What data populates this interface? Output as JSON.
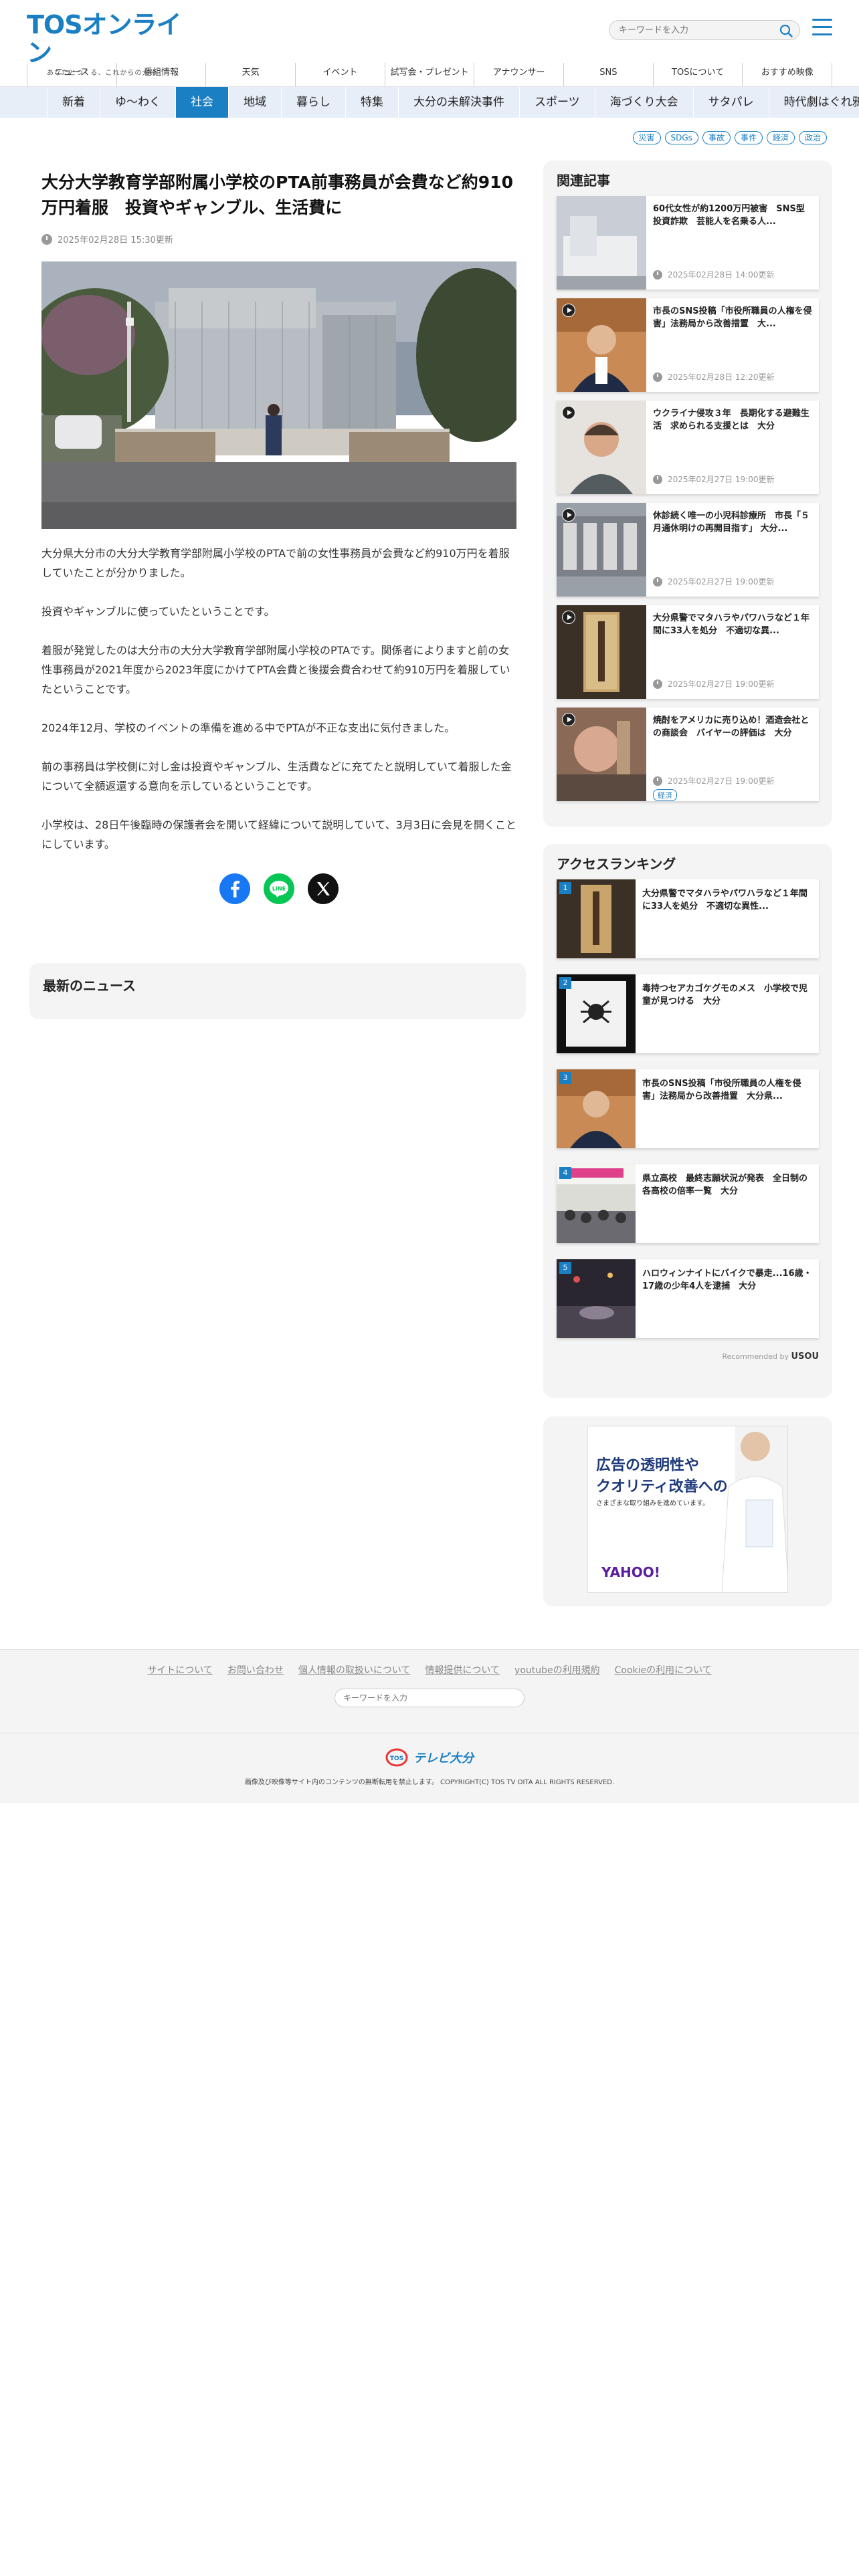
{
  "header": {
    "logo_main": "TOSオンライン",
    "logo_sub": "あなたとつくる、これからの大分",
    "search_placeholder": "キーワードを入力"
  },
  "top_nav": [
    "ニュース",
    "番組情報",
    "天気",
    "イベント",
    "試写会・プレゼント",
    "アナウンサー",
    "SNS",
    "TOSについて",
    "おすすめ映像"
  ],
  "category_nav": {
    "items": [
      "新着",
      "ゆ〜わく",
      "社会",
      "地域",
      "暮らし",
      "特集",
      "大分の未解決事件",
      "スポーツ",
      "海づくり大会",
      "サタパレ",
      "時代劇はぐれ鴉"
    ],
    "active": "社会"
  },
  "tags": [
    "災害",
    "SDGs",
    "事故",
    "事件",
    "経済",
    "政治"
  ],
  "article": {
    "title": "大分大学教育学部附属小学校のPTA前事務員が会費など約910万円着服　投資やギャンブル、生活費に",
    "date": "2025年02月28日 15:30更新",
    "paragraphs": [
      "大分県大分市の大分大学教育学部附属小学校のPTAで前の女性事務員が会費など約910万円を着服していたことが分かりました。",
      "投資やギャンブルに使っていたということです。",
      "着服が発覚したのは大分市の大分大学教育学部附属小学校のPTAです。関係者によりますと前の女性事務員が2021年度から2023年度にかけてPTA会費と後援会費合わせて約910万円を着服していたということです。",
      "2024年12月、学校のイベントの準備を進める中でPTAが不正な支出に気付きました。",
      "前の事務員は学校側に対し金は投資やギャンブル、生活費などに充てたと説明していて着服した金について全額返還する意向を示しているということです。",
      "小学校は、28日午後臨時の保護者会を開いて経緯について説明していて、3月3日に会見を開くことにしています。"
    ]
  },
  "share": {
    "line_label": "LINE"
  },
  "latest_news": {
    "title": "最新のニュース"
  },
  "related": {
    "title": "関連記事",
    "items": [
      {
        "title": "60代女性が約1200万円被害　SNS型投資詐欺　芸能人を名乗る人...",
        "date": "2025年02月28日 14:00更新",
        "video": false,
        "tag": ""
      },
      {
        "title": "市長のSNS投稿「市役所職員の人権を侵害」法務局から改善措置　大...",
        "date": "2025年02月28日 12:20更新",
        "video": true,
        "tag": ""
      },
      {
        "title": "ウクライナ侵攻３年　長期化する避難生活　求められる支援とは　大分",
        "date": "2025年02月27日 19:00更新",
        "video": true,
        "tag": ""
      },
      {
        "title": "休診続く唯一の小児科診療所　市長「５月通休明けの再開目指す」 大分...",
        "date": "2025年02月27日 19:00更新",
        "video": true,
        "tag": ""
      },
      {
        "title": "大分県警でマタハラやパワハラなど１年間に33人を処分　不適切な異...",
        "date": "2025年02月27日 19:00更新",
        "video": true,
        "tag": ""
      },
      {
        "title": "焼酎をアメリカに売り込め！酒造会社との商談会　バイヤーの評価は　大分",
        "date": "2025年02月27日 19:00更新",
        "video": true,
        "tag": "経済"
      }
    ]
  },
  "ranking": {
    "title": "アクセスランキング",
    "items": [
      {
        "rank": "1",
        "title": "大分県警でマタハラやパワハラなど１年間に33人を処分　不適切な異性..."
      },
      {
        "rank": "2",
        "title": "毒持つセアカゴケグモのメス　小学校で児童が見つける　大分"
      },
      {
        "rank": "3",
        "title": "市長のSNS投稿「市役所職員の人権を侵害」法務局から改善措置　大分県..."
      },
      {
        "rank": "4",
        "title": "県立高校　最終志願状況が発表　全日制の各高校の倍率一覧　大分"
      },
      {
        "rank": "5",
        "title": "ハロウィンナイトにバイクで暴走...16歳・17歳の少年4人を逮捕　大分"
      }
    ],
    "recommended_prefix": "Recommended by",
    "recommended_brand": "USOU"
  },
  "ad": {
    "line1": "広告の透明性や",
    "line2": "クオリティ改善への",
    "line3": "さまざまな取り組みを進めています。",
    "logo": "YAHOO!"
  },
  "footer": {
    "links": [
      "サイトについて",
      "お問い合わせ",
      "個人情報の取扱いについて",
      "情報提供について",
      "youtubeの利用規約",
      "Cookieの利用について"
    ],
    "search_placeholder": "キーワードを入力",
    "logo_text": "テレビ大分",
    "logo_mark": "TOS",
    "copyright": "画像及び映像等サイト内のコンテンツの無断転用を禁止します。 COPYRIGHT(C) TOS TV OITA ALL RIGHTS RESERVED."
  },
  "colors": {
    "accent": "#1b7fc4",
    "nav_bg": "#e8eef8",
    "panel_bg": "#f4f4f4"
  }
}
